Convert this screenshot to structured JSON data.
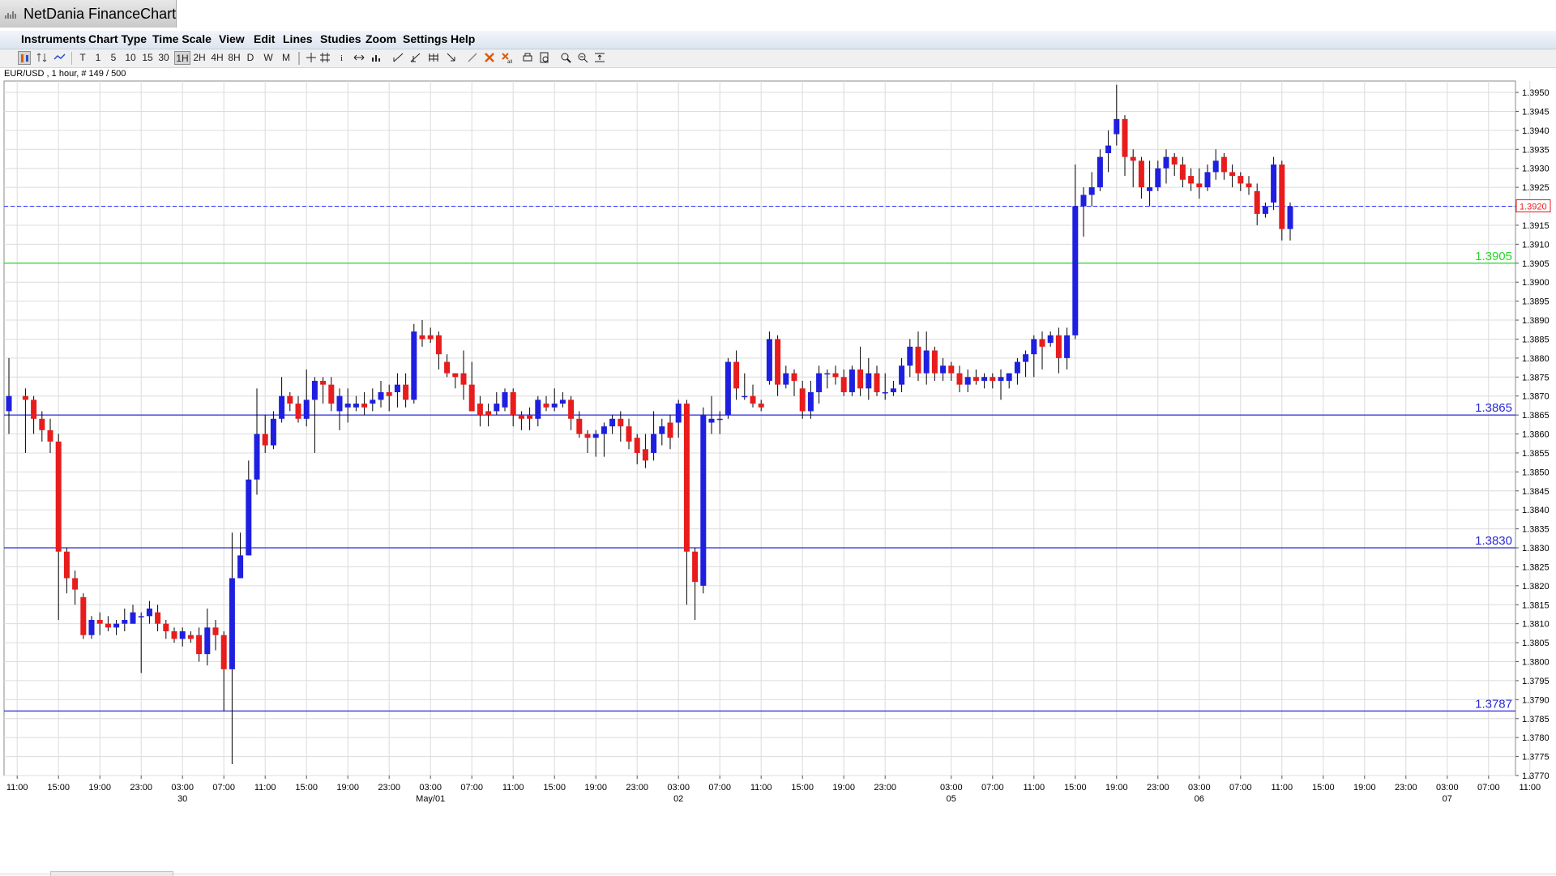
{
  "app": {
    "title": "NetDania FinanceChart"
  },
  "menu": [
    "Instruments",
    "Chart Type",
    "Time Scale",
    "View",
    "Edit",
    "Lines",
    "Studies",
    "Zoom",
    "Settings",
    "Help"
  ],
  "toolbar": {
    "intervals": [
      "T",
      "1",
      "5",
      "10",
      "15",
      "30",
      "1H",
      "2H",
      "4H",
      "8H",
      "D",
      "W",
      "M"
    ],
    "active_interval": "1H",
    "tools": [
      "chart-type-icon",
      "compare-icon",
      "line-chart-icon",
      "crosshair-icon",
      "grid-icon",
      "info-icon",
      "scroll-icon",
      "volume-icon",
      "trendline-icon",
      "fibonacci-icon",
      "channel-icon",
      "arrow-icon",
      "pen-icon",
      "delete-icon",
      "delete-all-icon",
      "print-icon",
      "print-preview-icon",
      "zoom-in-icon",
      "zoom-out-icon",
      "fit-icon"
    ]
  },
  "chart_info": "EUR/USD , 1 hour, # 149 / 500",
  "colors": {
    "up": "#1f1fe0",
    "down": "#e81c1c",
    "hline": "#2b2bd6",
    "green_line": "#27d827",
    "current_price": "#3a3aff",
    "grid": "#dcdcdc",
    "price_box_border": "#e81c1c"
  },
  "chart_data": {
    "type": "candlestick",
    "instrument": "EUR/USD",
    "interval": "1 hour",
    "ylim": [
      1.377,
      1.3953
    ],
    "y_ticks": [
      "1.3770",
      "1.3775",
      "1.3780",
      "1.3785",
      "1.3790",
      "1.3795",
      "1.3800",
      "1.3805",
      "1.3810",
      "1.3815",
      "1.3820",
      "1.3825",
      "1.3830",
      "1.3835",
      "1.3840",
      "1.3845",
      "1.3850",
      "1.3855",
      "1.3860",
      "1.3865",
      "1.3870",
      "1.3875",
      "1.3880",
      "1.3885",
      "1.3890",
      "1.3895",
      "1.3900",
      "1.3905",
      "1.3910",
      "1.3915",
      "1.3920",
      "1.3925",
      "1.3930",
      "1.3935",
      "1.3940",
      "1.3945",
      "1.3950"
    ],
    "time_labels": [
      {
        "i": 1,
        "time": "11:00",
        "date": ""
      },
      {
        "i": 6,
        "time": "15:00",
        "date": ""
      },
      {
        "i": 11,
        "time": "19:00",
        "date": ""
      },
      {
        "i": 16,
        "time": "23:00",
        "date": ""
      },
      {
        "i": 21,
        "time": "03:00",
        "date": "30"
      },
      {
        "i": 26,
        "time": "07:00",
        "date": ""
      },
      {
        "i": 31,
        "time": "11:00",
        "date": ""
      },
      {
        "i": 36,
        "time": "15:00",
        "date": ""
      },
      {
        "i": 41,
        "time": "19:00",
        "date": ""
      },
      {
        "i": 46,
        "time": "23:00",
        "date": ""
      },
      {
        "i": 51,
        "time": "03:00",
        "date": "May/01"
      },
      {
        "i": 56,
        "time": "07:00",
        "date": ""
      },
      {
        "i": 61,
        "time": "11:00",
        "date": ""
      },
      {
        "i": 66,
        "time": "15:00",
        "date": ""
      },
      {
        "i": 71,
        "time": "19:00",
        "date": ""
      },
      {
        "i": 76,
        "time": "23:00",
        "date": ""
      },
      {
        "i": 81,
        "time": "03:00",
        "date": "02"
      },
      {
        "i": 86,
        "time": "07:00",
        "date": ""
      },
      {
        "i": 91,
        "time": "11:00",
        "date": ""
      },
      {
        "i": 96,
        "time": "15:00",
        "date": ""
      },
      {
        "i": 101,
        "time": "19:00",
        "date": ""
      },
      {
        "i": 106,
        "time": "23:00",
        "date": ""
      },
      {
        "i": 114,
        "time": "03:00",
        "date": "05"
      },
      {
        "i": 119,
        "time": "07:00",
        "date": ""
      },
      {
        "i": 124,
        "time": "11:00",
        "date": ""
      },
      {
        "i": 129,
        "time": "15:00",
        "date": ""
      },
      {
        "i": 134,
        "time": "19:00",
        "date": ""
      },
      {
        "i": 139,
        "time": "23:00",
        "date": ""
      },
      {
        "i": 144,
        "time": "03:00",
        "date": "06"
      },
      {
        "i": 149,
        "time": "07:00",
        "date": ""
      },
      {
        "i": 154,
        "time": "11:00",
        "date": ""
      },
      {
        "i": 159,
        "time": "15:00",
        "date": ""
      },
      {
        "i": 164,
        "time": "19:00",
        "date": ""
      },
      {
        "i": 169,
        "time": "23:00",
        "date": ""
      },
      {
        "i": 174,
        "time": "03:00",
        "date": "07"
      },
      {
        "i": 179,
        "time": "07:00",
        "date": ""
      },
      {
        "i": 184,
        "time": "11:00",
        "date": ""
      }
    ],
    "horizontal_lines": [
      {
        "value": 1.3905,
        "label": "1.3905",
        "color": "#27d827"
      },
      {
        "value": 1.3865,
        "label": "1.3865",
        "color": "#2b2bd6"
      },
      {
        "value": 1.383,
        "label": "1.3830",
        "color": "#2b2bd6"
      },
      {
        "value": 1.3787,
        "label": "1.3787",
        "color": "#2b2bd6"
      }
    ],
    "current_price": {
      "value": 1.392,
      "label": "1.3920"
    },
    "candles": [
      [
        0,
        1.3866,
        1.387,
        1.388,
        1.386
      ],
      [
        2,
        1.387,
        1.3869,
        1.3872,
        1.3855
      ],
      [
        3,
        1.3869,
        1.3864,
        1.387,
        1.386
      ],
      [
        4,
        1.3864,
        1.3861,
        1.3866,
        1.3858
      ],
      [
        5,
        1.3861,
        1.3858,
        1.3864,
        1.3855
      ],
      [
        6,
        1.3858,
        1.3829,
        1.386,
        1.3811
      ],
      [
        7,
        1.3829,
        1.3822,
        1.383,
        1.3818
      ],
      [
        8,
        1.3822,
        1.3819,
        1.3824,
        1.3815
      ],
      [
        9,
        1.3817,
        1.3807,
        1.3818,
        1.3806
      ],
      [
        10,
        1.3807,
        1.3811,
        1.3812,
        1.3806
      ],
      [
        11,
        1.3811,
        1.381,
        1.3813,
        1.3807
      ],
      [
        12,
        1.381,
        1.3809,
        1.3812,
        1.3808
      ],
      [
        13,
        1.3809,
        1.381,
        1.3811,
        1.3807
      ],
      [
        14,
        1.381,
        1.3811,
        1.3814,
        1.3808
      ],
      [
        15,
        1.381,
        1.3813,
        1.3815,
        1.381
      ],
      [
        16,
        1.3812,
        1.3812,
        1.3813,
        1.3797
      ],
      [
        17,
        1.3812,
        1.3814,
        1.3816,
        1.381
      ],
      [
        18,
        1.3813,
        1.381,
        1.3815,
        1.3808
      ],
      [
        19,
        1.381,
        1.3808,
        1.3811,
        1.3806
      ],
      [
        20,
        1.3808,
        1.3806,
        1.3809,
        1.3805
      ],
      [
        21,
        1.3806,
        1.3808,
        1.3809,
        1.3804
      ],
      [
        22,
        1.3807,
        1.3806,
        1.3808,
        1.3805
      ],
      [
        23,
        1.3807,
        1.3802,
        1.3809,
        1.38
      ],
      [
        24,
        1.3802,
        1.3809,
        1.3814,
        1.3799
      ],
      [
        25,
        1.3809,
        1.3807,
        1.3811,
        1.3803
      ],
      [
        26,
        1.3807,
        1.3798,
        1.3808,
        1.3787
      ],
      [
        27,
        1.3798,
        1.3822,
        1.3834,
        1.3773
      ],
      [
        28,
        1.3822,
        1.3828,
        1.3834,
        1.3822
      ],
      [
        29,
        1.3828,
        1.3848,
        1.3853,
        1.3828
      ],
      [
        30,
        1.3848,
        1.386,
        1.3872,
        1.3844
      ],
      [
        31,
        1.386,
        1.3857,
        1.3865,
        1.3855
      ],
      [
        32,
        1.3857,
        1.3864,
        1.3866,
        1.3856
      ],
      [
        33,
        1.3864,
        1.387,
        1.3875,
        1.3863
      ],
      [
        34,
        1.387,
        1.3868,
        1.3871,
        1.3866
      ],
      [
        35,
        1.3868,
        1.3864,
        1.387,
        1.3863
      ],
      [
        36,
        1.3864,
        1.3869,
        1.3877,
        1.3862
      ],
      [
        37,
        1.3869,
        1.3874,
        1.3875,
        1.3855
      ],
      [
        38,
        1.3874,
        1.3873,
        1.3875,
        1.3868
      ],
      [
        39,
        1.3873,
        1.3868,
        1.3875,
        1.3866
      ],
      [
        40,
        1.3866,
        1.387,
        1.3872,
        1.3861
      ],
      [
        41,
        1.3867,
        1.3868,
        1.3872,
        1.3863
      ],
      [
        42,
        1.3867,
        1.3868,
        1.387,
        1.3866
      ],
      [
        43,
        1.3868,
        1.3867,
        1.3871,
        1.3865
      ],
      [
        44,
        1.3868,
        1.3869,
        1.3872,
        1.3866
      ],
      [
        45,
        1.3869,
        1.3871,
        1.3874,
        1.3867
      ],
      [
        46,
        1.3871,
        1.387,
        1.3873,
        1.3866
      ],
      [
        47,
        1.3871,
        1.3873,
        1.3876,
        1.3867
      ],
      [
        48,
        1.3873,
        1.3869,
        1.3876,
        1.3867
      ],
      [
        49,
        1.3869,
        1.3887,
        1.3889,
        1.3868
      ],
      [
        50,
        1.3886,
        1.3885,
        1.389,
        1.3883
      ],
      [
        51,
        1.3886,
        1.3885,
        1.3888,
        1.3884
      ],
      [
        52,
        1.3886,
        1.3881,
        1.3887,
        1.3877
      ],
      [
        53,
        1.3879,
        1.3876,
        1.3881,
        1.3875
      ],
      [
        54,
        1.3876,
        1.3875,
        1.3876,
        1.3872
      ],
      [
        55,
        1.3876,
        1.3873,
        1.3882,
        1.3869
      ],
      [
        56,
        1.3873,
        1.3866,
        1.3879,
        1.3866
      ],
      [
        57,
        1.3868,
        1.3865,
        1.387,
        1.3862
      ],
      [
        58,
        1.3866,
        1.3865,
        1.3868,
        1.3862
      ],
      [
        59,
        1.3866,
        1.3868,
        1.3871,
        1.3865
      ],
      [
        60,
        1.3867,
        1.3871,
        1.3872,
        1.3866
      ],
      [
        61,
        1.3871,
        1.3865,
        1.3872,
        1.3862
      ],
      [
        62,
        1.3865,
        1.3864,
        1.3866,
        1.3861
      ],
      [
        63,
        1.3865,
        1.3864,
        1.3867,
        1.3861
      ],
      [
        64,
        1.3864,
        1.3869,
        1.387,
        1.3862
      ],
      [
        65,
        1.3868,
        1.3867,
        1.387,
        1.3866
      ],
      [
        66,
        1.3867,
        1.3868,
        1.3872,
        1.3866
      ],
      [
        67,
        1.3868,
        1.3869,
        1.3871,
        1.3867
      ],
      [
        68,
        1.3869,
        1.3864,
        1.387,
        1.3861
      ],
      [
        69,
        1.3864,
        1.386,
        1.3866,
        1.3859
      ],
      [
        70,
        1.386,
        1.3859,
        1.3861,
        1.3855
      ],
      [
        71,
        1.3859,
        1.386,
        1.3861,
        1.3854
      ],
      [
        72,
        1.386,
        1.3862,
        1.3863,
        1.3854
      ],
      [
        73,
        1.3862,
        1.3864,
        1.3865,
        1.386
      ],
      [
        74,
        1.3864,
        1.3862,
        1.3866,
        1.3858
      ],
      [
        75,
        1.3862,
        1.3858,
        1.3864,
        1.3856
      ],
      [
        76,
        1.3859,
        1.3855,
        1.386,
        1.3852
      ],
      [
        77,
        1.3856,
        1.3853,
        1.386,
        1.3851
      ],
      [
        78,
        1.3855,
        1.386,
        1.3866,
        1.3853
      ],
      [
        79,
        1.386,
        1.3862,
        1.3864,
        1.3857
      ],
      [
        80,
        1.3863,
        1.3859,
        1.3865,
        1.3856
      ],
      [
        81,
        1.3863,
        1.3868,
        1.3869,
        1.3859
      ],
      [
        82,
        1.3868,
        1.3829,
        1.3869,
        1.3815
      ],
      [
        83,
        1.3829,
        1.3821,
        1.383,
        1.3811
      ],
      [
        84,
        1.382,
        1.3865,
        1.3867,
        1.3818
      ],
      [
        85,
        1.3863,
        1.3864,
        1.387,
        1.386
      ],
      [
        86,
        1.3864,
        1.3864,
        1.3866,
        1.386
      ],
      [
        87,
        1.3865,
        1.3879,
        1.388,
        1.3864
      ],
      [
        88,
        1.3879,
        1.3872,
        1.3882,
        1.3869
      ],
      [
        89,
        1.387,
        1.387,
        1.3876,
        1.3869
      ],
      [
        90,
        1.387,
        1.3868,
        1.3873,
        1.3867
      ],
      [
        91,
        1.3868,
        1.3867,
        1.3869,
        1.3866
      ],
      [
        92,
        1.3874,
        1.3885,
        1.3887,
        1.3873
      ],
      [
        93,
        1.3885,
        1.3873,
        1.3886,
        1.387
      ],
      [
        94,
        1.3873,
        1.3876,
        1.3878,
        1.3872
      ],
      [
        95,
        1.3876,
        1.3874,
        1.3877,
        1.387
      ],
      [
        96,
        1.3872,
        1.3866,
        1.3874,
        1.3864
      ],
      [
        97,
        1.3866,
        1.3871,
        1.3874,
        1.3864
      ],
      [
        98,
        1.3871,
        1.3876,
        1.3878,
        1.3868
      ],
      [
        99,
        1.3876,
        1.3876,
        1.3877,
        1.3872
      ],
      [
        100,
        1.3876,
        1.3875,
        1.3878,
        1.3873
      ],
      [
        101,
        1.3875,
        1.3871,
        1.3877,
        1.387
      ],
      [
        102,
        1.3871,
        1.3877,
        1.3878,
        1.387
      ],
      [
        103,
        1.3877,
        1.3872,
        1.3883,
        1.387
      ],
      [
        104,
        1.3872,
        1.3876,
        1.388,
        1.3869
      ],
      [
        105,
        1.3876,
        1.3871,
        1.3878,
        1.387
      ],
      [
        106,
        1.3871,
        1.3871,
        1.3876,
        1.3869
      ],
      [
        107,
        1.3871,
        1.3872,
        1.3874,
        1.387
      ],
      [
        108,
        1.3873,
        1.3878,
        1.388,
        1.3871
      ],
      [
        109,
        1.3878,
        1.3883,
        1.3885,
        1.3875
      ],
      [
        110,
        1.3883,
        1.3876,
        1.3887,
        1.3874
      ],
      [
        111,
        1.3876,
        1.3882,
        1.3887,
        1.3873
      ],
      [
        112,
        1.3882,
        1.3876,
        1.3883,
        1.3874
      ],
      [
        113,
        1.3876,
        1.3878,
        1.388,
        1.3874
      ],
      [
        114,
        1.3878,
        1.3876,
        1.3879,
        1.3874
      ],
      [
        115,
        1.3876,
        1.3873,
        1.3878,
        1.3871
      ],
      [
        116,
        1.3873,
        1.3875,
        1.3877,
        1.3871
      ],
      [
        117,
        1.3875,
        1.3874,
        1.3877,
        1.3873
      ],
      [
        118,
        1.3874,
        1.3875,
        1.3876,
        1.3872
      ],
      [
        119,
        1.3875,
        1.3874,
        1.3876,
        1.3872
      ],
      [
        120,
        1.3874,
        1.3875,
        1.3877,
        1.3869
      ],
      [
        121,
        1.3874,
        1.3876,
        1.3876,
        1.3872
      ],
      [
        122,
        1.3876,
        1.3879,
        1.388,
        1.3873
      ],
      [
        123,
        1.3879,
        1.3881,
        1.3882,
        1.3875
      ],
      [
        124,
        1.3881,
        1.3885,
        1.3886,
        1.3875
      ],
      [
        125,
        1.3885,
        1.3883,
        1.3887,
        1.3877
      ],
      [
        126,
        1.3884,
        1.3886,
        1.3887,
        1.3883
      ],
      [
        127,
        1.3886,
        1.388,
        1.3888,
        1.3876
      ],
      [
        128,
        1.388,
        1.3886,
        1.3888,
        1.3877
      ],
      [
        129,
        1.3886,
        1.392,
        1.3931,
        1.3885
      ],
      [
        130,
        1.392,
        1.3923,
        1.3925,
        1.3912
      ],
      [
        131,
        1.3923,
        1.3925,
        1.3929,
        1.392
      ],
      [
        132,
        1.3925,
        1.3933,
        1.3935,
        1.3924
      ],
      [
        133,
        1.3934,
        1.3936,
        1.394,
        1.3929
      ],
      [
        134,
        1.3939,
        1.3943,
        1.3952,
        1.3936
      ],
      [
        135,
        1.3943,
        1.3933,
        1.3944,
        1.3928
      ],
      [
        136,
        1.3933,
        1.3932,
        1.3935,
        1.3925
      ],
      [
        137,
        1.3932,
        1.3925,
        1.3933,
        1.3922
      ],
      [
        138,
        1.3924,
        1.3925,
        1.3932,
        1.392
      ],
      [
        139,
        1.3925,
        1.393,
        1.3932,
        1.3924
      ],
      [
        140,
        1.393,
        1.3933,
        1.3935,
        1.3926
      ],
      [
        141,
        1.3933,
        1.3931,
        1.3934,
        1.3928
      ],
      [
        142,
        1.3931,
        1.3927,
        1.3933,
        1.3925
      ],
      [
        143,
        1.3928,
        1.3926,
        1.393,
        1.3924
      ],
      [
        144,
        1.3926,
        1.3925,
        1.393,
        1.3922
      ],
      [
        145,
        1.3925,
        1.3929,
        1.3931,
        1.3924
      ],
      [
        146,
        1.3929,
        1.3932,
        1.3935,
        1.3927
      ],
      [
        147,
        1.3933,
        1.3929,
        1.3934,
        1.3927
      ],
      [
        148,
        1.3929,
        1.3928,
        1.3931,
        1.3925
      ],
      [
        149,
        1.3928,
        1.3926,
        1.3929,
        1.3924
      ],
      [
        150,
        1.3926,
        1.3925,
        1.3928,
        1.3923
      ],
      [
        151,
        1.3924,
        1.3918,
        1.3926,
        1.3915
      ],
      [
        152,
        1.3918,
        1.392,
        1.3921,
        1.3917
      ],
      [
        153,
        1.3921,
        1.3931,
        1.3933,
        1.3919
      ],
      [
        154,
        1.3931,
        1.3914,
        1.3932,
        1.3911
      ],
      [
        155,
        1.3914,
        1.392,
        1.3921,
        1.3911
      ]
    ]
  }
}
